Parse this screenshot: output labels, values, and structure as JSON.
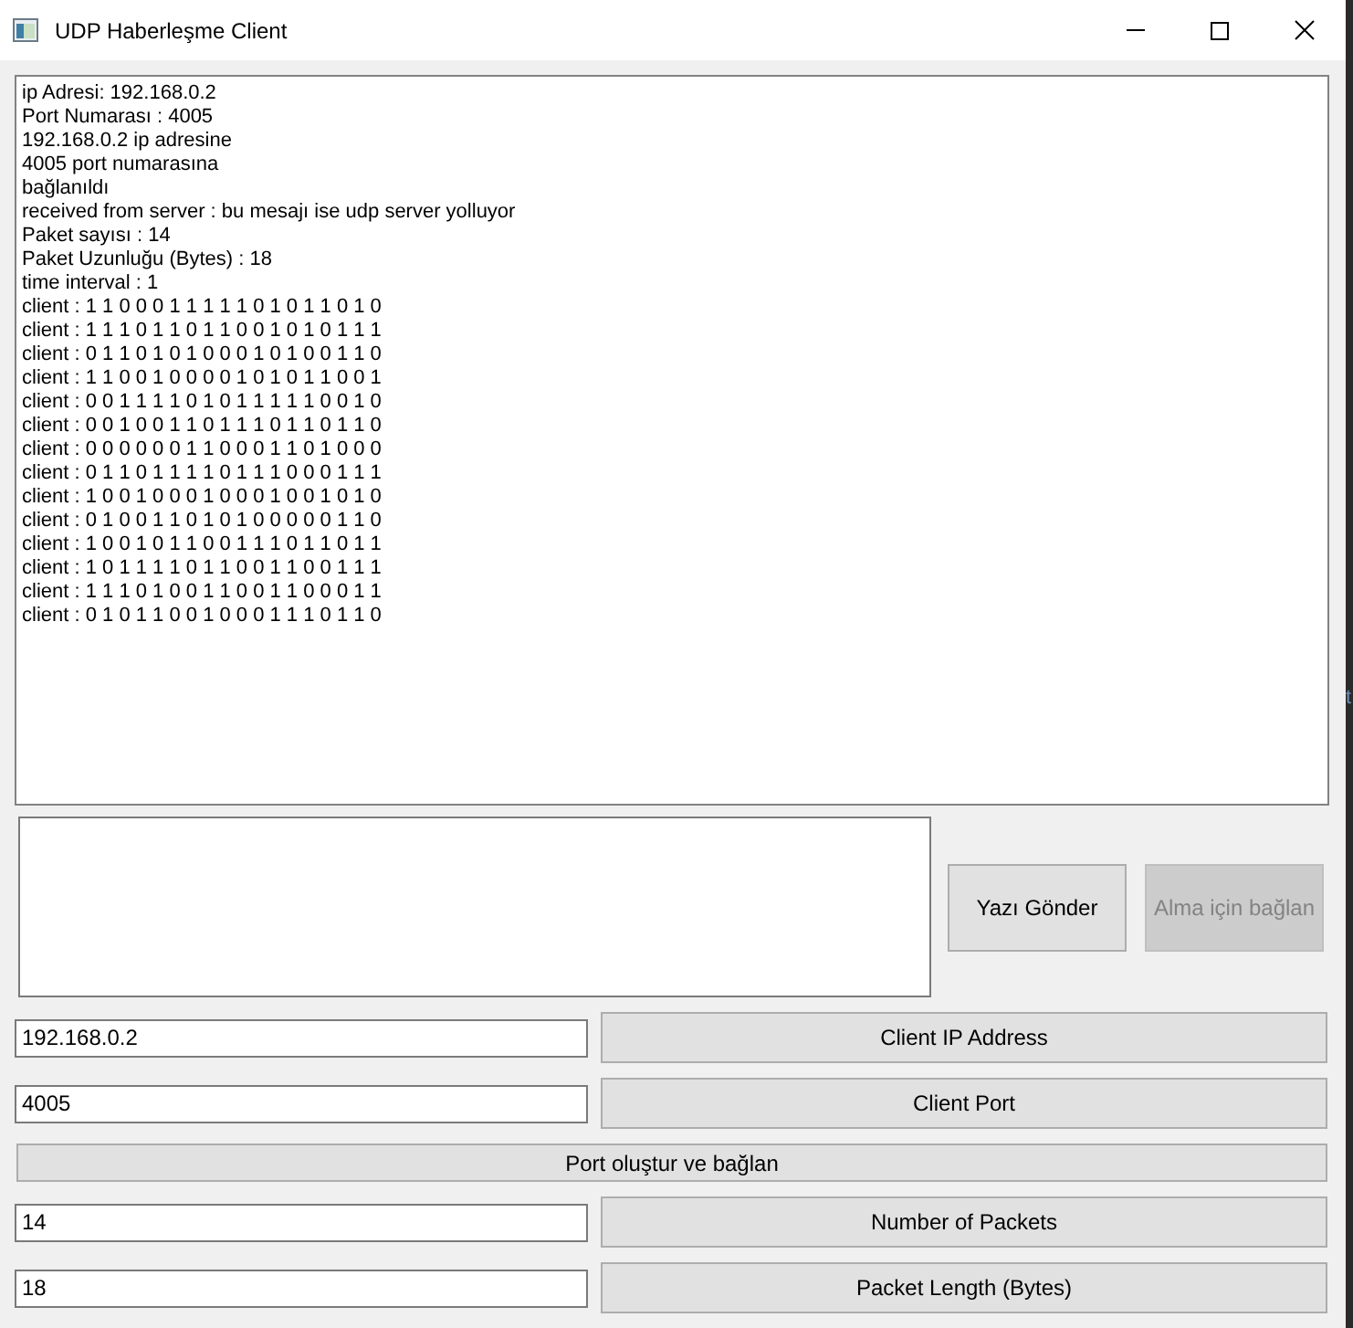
{
  "window": {
    "title": "UDP Haberleşme Client"
  },
  "log": {
    "lines": [
      "ip Adresi: 192.168.0.2",
      "Port Numarası : 4005",
      "192.168.0.2 ip adresine",
      "4005 port numarasına",
      "bağlanıldı",
      "received from server : bu mesajı ise udp server yolluyor",
      "Paket sayısı : 14",
      "Paket Uzunluğu (Bytes) : 18",
      "time interval : 1",
      "client : 1 1 0 0 0 1 1 1 1 1 0 1 0 1 1 0 1 0",
      "client : 1 1 1 0 1 1 0 1 1 0 0 1 0 1 0 1 1 1",
      "client : 0 1 1 0 1 0 1 0 0 0 1 0 1 0 0 1 1 0",
      "client : 1 1 0 0 1 0 0 0 0 1 0 1 0 1 1 0 0 1",
      "client : 0 0 1 1 1 1 0 1 0 1 1 1 1 1 0 0 1 0",
      "client : 0 0 1 0 0 1 1 0 1 1 1 0 1 1 0 1 1 0",
      "client : 0 0 0 0 0 0 1 1 0 0 0 1 1 0 1 0 0 0",
      "client : 0 1 1 0 1 1 1 1 0 1 1 1 0 0 0 1 1 1",
      "client : 1 0 0 1 0 0 0 1 0 0 0 1 0 0 1 0 1 0",
      "client : 0 1 0 0 1 1 0 1 0 1 0 0 0 0 0 1 1 0",
      "client : 1 0 0 1 0 1 1 0 0 1 1 1 0 1 1 0 1 1",
      "client : 1 0 1 1 1 1 0 1 1 0 0 1 1 0 0 1 1 1",
      "client : 1 1 1 0 1 0 0 1 1 0 0 1 1 0 0 0 1 1",
      "client : 0 1 0 1 1 0 0 1 0 0 0 1 1 1 0 1 1 0"
    ]
  },
  "message_panel": {
    "buttons": [
      {
        "label": "Yazı Gönder",
        "disabled": false
      },
      {
        "label": "Alma için bağlan",
        "disabled": true
      }
    ]
  },
  "settings": {
    "rows": [
      {
        "kind": "field",
        "value": "192.168.0.2",
        "button": "Client IP Address"
      },
      {
        "kind": "field",
        "value": "4005",
        "button": "Client Port"
      },
      {
        "kind": "button",
        "button": "Port oluştur ve bağlan"
      },
      {
        "kind": "field",
        "value": "14",
        "button": "Number of Packets"
      },
      {
        "kind": "field",
        "value": "18",
        "button": "Packet Length (Bytes)"
      }
    ]
  },
  "background_fragment": "t"
}
